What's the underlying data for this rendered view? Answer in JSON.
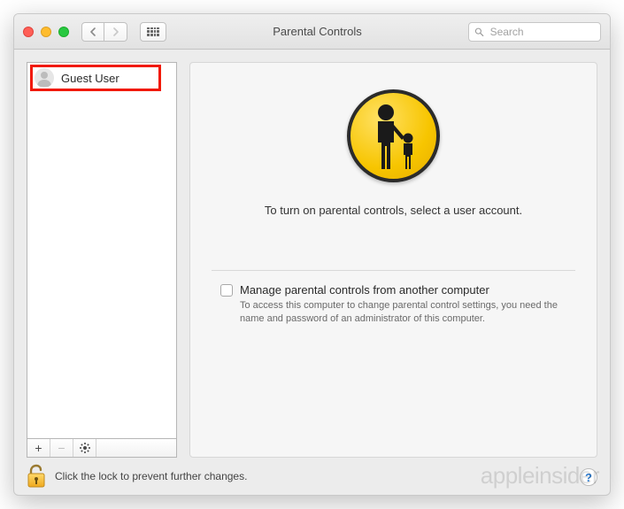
{
  "titlebar": {
    "window_title": "Parental Controls",
    "search_placeholder": "Search"
  },
  "sidebar": {
    "users": [
      {
        "name": "Guest User"
      }
    ],
    "add_label": "+",
    "remove_label": "−"
  },
  "main": {
    "instruction": "To turn on parental controls, select a user account.",
    "manage_checkbox_label": "Manage parental controls from another computer",
    "manage_checkbox_desc": "To access this computer to change parental control settings, you need the name and password of an administrator of this computer."
  },
  "footer": {
    "lock_text": "Click the lock to prevent further changes.",
    "help_label": "?"
  },
  "watermark": "appleinsider"
}
